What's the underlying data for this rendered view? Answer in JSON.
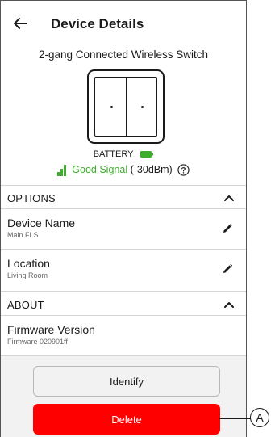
{
  "header": {
    "title": "Device Details"
  },
  "device": {
    "name": "2-gang Connected Wireless Switch",
    "battery_label": "BATTERY",
    "signal_quality": "Good Signal",
    "signal_strength": "(-30dBm)"
  },
  "options": {
    "label": "OPTIONS",
    "items": [
      {
        "title": "Device Name",
        "value": "Main FLS"
      },
      {
        "title": "Location",
        "value": "Living Room"
      }
    ]
  },
  "about": {
    "label": "ABOUT",
    "items": [
      {
        "title": "Firmware Version",
        "value": "Firmware 020901ff"
      }
    ]
  },
  "actions": {
    "identify_label": "Identify",
    "delete_label": "Delete"
  },
  "callout": {
    "label": "A"
  },
  "colors": {
    "accent_green": "#3dae2b",
    "delete_red": "#ff0000",
    "background": "#f2f2f2"
  },
  "icons": [
    "back-arrow-icon",
    "switch-device-icon",
    "battery-icon",
    "signal-bars-icon",
    "help-icon",
    "chevron-up-icon",
    "pencil-icon"
  ]
}
